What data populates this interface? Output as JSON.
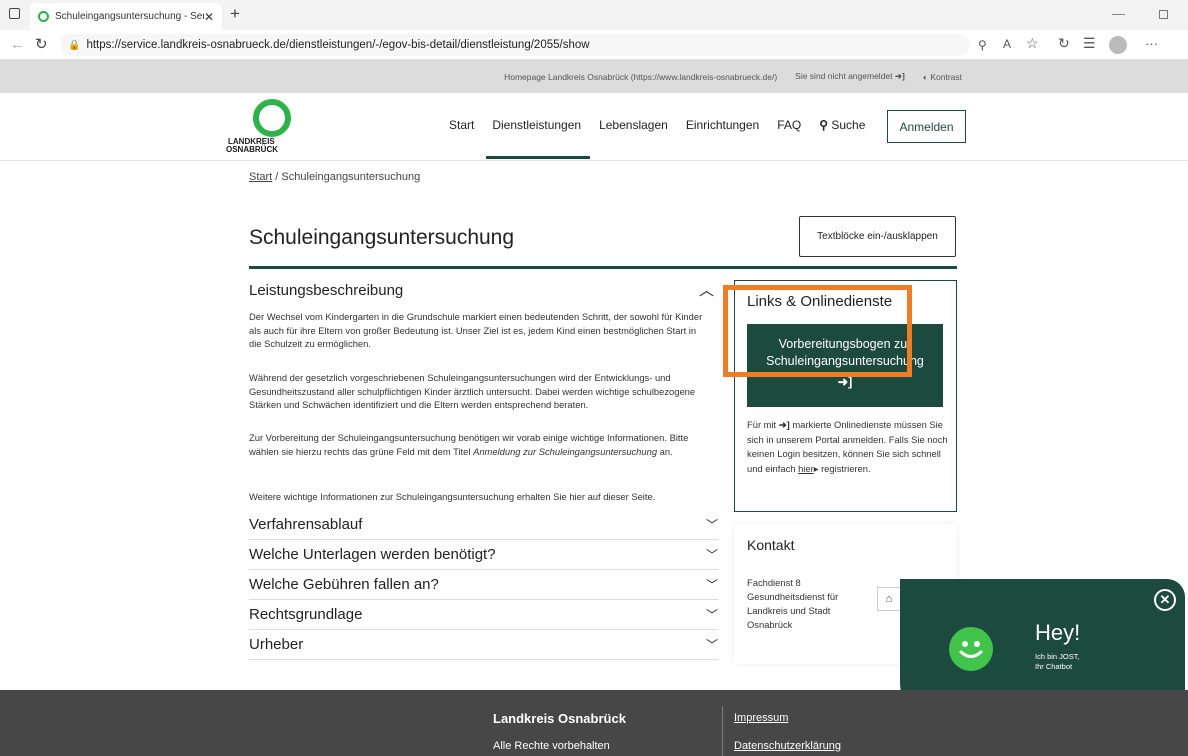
{
  "browser": {
    "tab_title": "Schuleingangsuntersuchung - Ser",
    "url": "https://service.landkreis-osnabrueck.de/dienstleistungen/-/egov-bis-detail/dienstleistung/2055/show"
  },
  "topstrip": {
    "homepage": "Homepage Landkreis Osnabrück (https://www.landkreis-osnabrueck.de/)",
    "login_status": "Sie sind nicht angemeldet",
    "contrast": "Kontrast"
  },
  "logo": {
    "line1": "LANDKREIS",
    "line2": "OSNABRÜCK"
  },
  "nav": {
    "items": [
      "Start",
      "Dienstleistungen",
      "Lebenslagen",
      "Einrichtungen",
      "FAQ",
      "Suche"
    ],
    "login": "Anmelden"
  },
  "breadcrumb": {
    "home": "Start",
    "separator": "/",
    "current": "Schuleingangsuntersuchung"
  },
  "page": {
    "title": "Schuleingangsuntersuchung",
    "toggle_button": "Textblöcke ein-/ausklappen"
  },
  "accordion": {
    "open_title": "Leistungsbeschreibung",
    "paragraphs": [
      "Der Wechsel vom Kindergarten in die Grundschule markiert einen bedeutenden Schritt, der sowohl für Kinder als auch für ihre Eltern von großer Bedeutung ist. Unser Ziel ist es, jedem Kind einen bestmöglichen Start in die Schulzeit zu ermöglichen.",
      "Während der gesetzlich vorgeschriebenen Schuleingangsuntersuchungen wird der Entwicklungs- und Gesundheitszustand aller schulpflichtigen Kinder ärztlich untersucht. Dabei werden wichtige schulbezogene Stärken und Schwächen identifiziert und die Eltern werden entsprechend beraten.",
      "Weitere wichtige Informationen zur Schuleingangsuntersuchung erhalten Sie hier auf dieser Seite."
    ],
    "para3_start": "Zur Vorbereitung der Schuleingangsuntersuchung benötigen wir vorab einige wichtige Informationen. Bitte wählen sie hierzu rechts das grüne Feld mit dem Titel ",
    "para3_emph": "Anmeldung zur Schuleingangsuntersuchung",
    "para3_end": " an.",
    "collapsed": [
      "Verfahrensablauf",
      "Welche Unterlagen werden benötigt?",
      "Welche Gebühren fallen an?",
      "Rechtsgrundlage",
      "Urheber"
    ]
  },
  "sidebar": {
    "links_title": "Links & Onlinedienste",
    "button_label": "Vorbereitungsbogen zur Schuleingangsuntersuchung",
    "note_start": "Für mit",
    "note_mid": "markierte Onlinedienste müssen Sie sich in unserem Portal anmelden. Falls Sie noch keinen Login besitzen, können Sie sich schnell und einfach",
    "note_link": "hier",
    "note_end": "registrieren.",
    "kontakt_title": "Kontakt",
    "kontakt_text": "Fachdienst 8 Gesundheitsdienst für Landkreis und Stadt Osnabrück"
  },
  "chatbot": {
    "greeting": "Hey!",
    "subtitle_1": "Ich bin JOST,",
    "subtitle_2": "Ihr Chatbot"
  },
  "footer": {
    "title": "Landkreis Osnabrück",
    "rights": "Alle Rechte vorbehalten",
    "link_1": "Impressum",
    "link_2": "Datenschutzerklärung"
  },
  "colors": {
    "brand_dark": "#1d4a3e",
    "logo_green": "#2db34a",
    "highlight": "#f07d25",
    "footer": "#474747"
  }
}
